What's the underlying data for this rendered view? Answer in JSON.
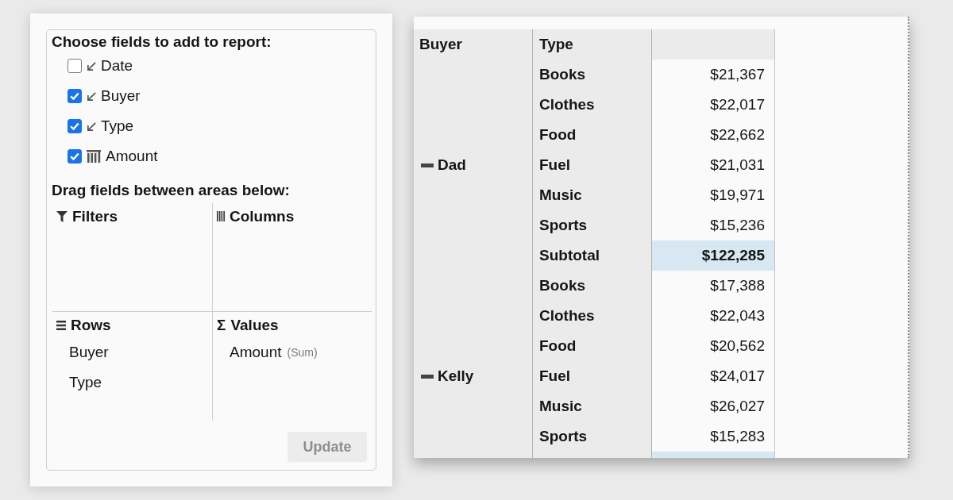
{
  "field_panel": {
    "fields_heading": "Choose fields to add to report:",
    "fields": [
      {
        "label": "Date",
        "kind": "dimension",
        "checked": false
      },
      {
        "label": "Buyer",
        "kind": "dimension",
        "checked": true
      },
      {
        "label": "Type",
        "kind": "dimension",
        "checked": true
      },
      {
        "label": "Amount",
        "kind": "measure",
        "checked": true
      }
    ],
    "areas_heading": "Drag fields between areas below:",
    "areas": [
      {
        "kind": "filters",
        "title": "Filters"
      },
      {
        "kind": "columns",
        "title": "Columns"
      },
      {
        "kind": "rows",
        "title": "Rows",
        "items": [
          {
            "label": "Buyer"
          },
          {
            "label": "Type"
          }
        ]
      },
      {
        "kind": "values",
        "symbol": "Σ",
        "title": "Values",
        "items": [
          {
            "label": "Amount",
            "aggregate": "(Sum)"
          }
        ]
      }
    ],
    "update_button": {
      "label": "Update",
      "disabled": true
    }
  },
  "pivot_grid": {
    "row_headers": [
      "Buyer",
      "Type"
    ],
    "groups": [
      {
        "buyer": "Dad",
        "expanded": true,
        "rows": [
          {
            "kind": "item",
            "type": "Books",
            "value": "$21,367"
          },
          {
            "kind": "item",
            "type": "Clothes",
            "value": "$22,017"
          },
          {
            "kind": "item",
            "type": "Food",
            "value": "$22,662"
          },
          {
            "kind": "item",
            "type": "Fuel",
            "value": "$21,031"
          },
          {
            "kind": "item",
            "type": "Music",
            "value": "$19,971"
          },
          {
            "kind": "item",
            "type": "Sports",
            "value": "$15,236"
          },
          {
            "kind": "subtotal",
            "type": "Subtotal",
            "value": "$122,285"
          }
        ]
      },
      {
        "buyer": "Kelly",
        "expanded": true,
        "rows": [
          {
            "kind": "item",
            "type": "Books",
            "value": "$17,388"
          },
          {
            "kind": "item",
            "type": "Clothes",
            "value": "$22,043"
          },
          {
            "kind": "item",
            "type": "Food",
            "value": "$20,562"
          },
          {
            "kind": "item",
            "type": "Fuel",
            "value": "$24,017"
          },
          {
            "kind": "item",
            "type": "Music",
            "value": "$26,027"
          },
          {
            "kind": "item",
            "type": "Sports",
            "value": "$15,283"
          },
          {
            "kind": "subtotal"
          }
        ]
      }
    ]
  }
}
